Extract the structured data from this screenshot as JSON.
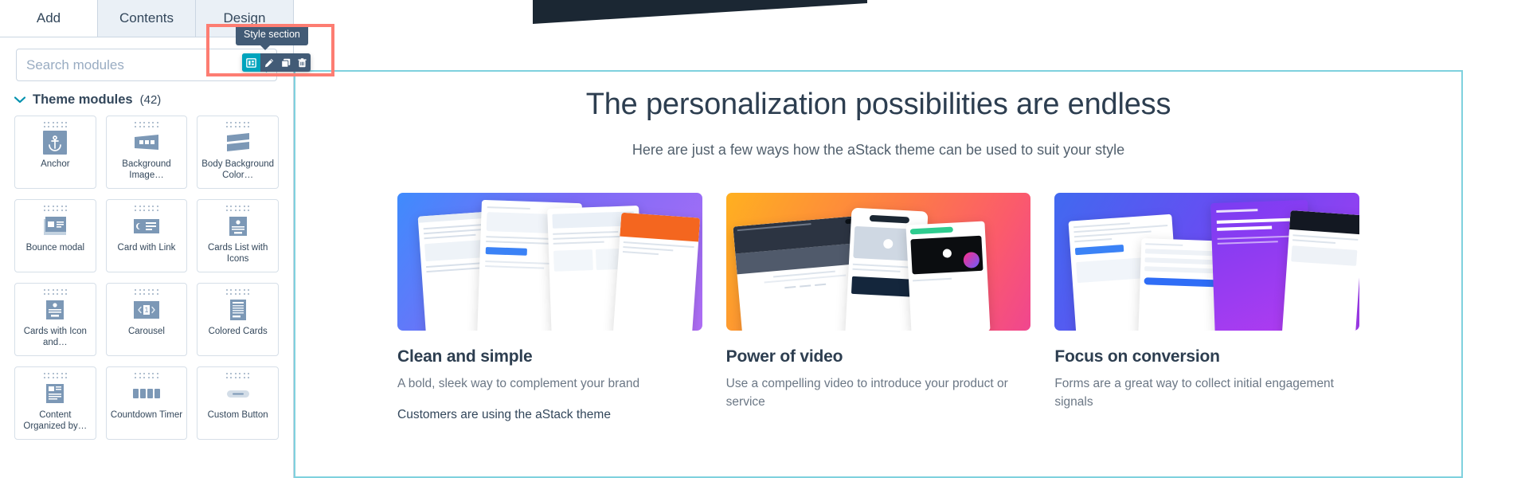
{
  "left_panel": {
    "tabs": [
      {
        "label": "Add",
        "active": true
      },
      {
        "label": "Contents",
        "active": false
      },
      {
        "label": "Design",
        "active": false
      }
    ],
    "search": {
      "placeholder": "Search modules",
      "value": "",
      "icon": "search-icon"
    },
    "section": {
      "chevron_icon": "chevron-down-icon",
      "title": "Theme modules",
      "count": "(42)"
    },
    "modules": [
      {
        "label": "Anchor",
        "icon": "anchor-icon"
      },
      {
        "label": "Background Image…",
        "icon": "background-image-icon"
      },
      {
        "label": "Body Background Color…",
        "icon": "body-background-color-icon"
      },
      {
        "label": "Bounce modal",
        "icon": "bounce-modal-icon"
      },
      {
        "label": "Card with Link",
        "icon": "card-with-link-icon"
      },
      {
        "label": "Cards List with Icons",
        "icon": "cards-list-with-icons-icon"
      },
      {
        "label": "Cards with Icon and…",
        "icon": "cards-with-icon-icon"
      },
      {
        "label": "Carousel",
        "icon": "carousel-icon"
      },
      {
        "label": "Colored Cards",
        "icon": "colored-cards-icon"
      },
      {
        "label": "Content Organized by…",
        "icon": "content-organized-icon"
      },
      {
        "label": "Countdown Timer",
        "icon": "countdown-timer-icon"
      },
      {
        "label": "Custom Button",
        "icon": "custom-button-icon"
      }
    ]
  },
  "section_toolbar": {
    "tooltip": "Style section",
    "buttons": [
      {
        "name": "style-section-button",
        "icon": "layout-style-icon",
        "active": true
      },
      {
        "name": "edit-section-button",
        "icon": "pencil-icon",
        "active": false
      },
      {
        "name": "clone-section-button",
        "icon": "copy-icon",
        "active": false
      },
      {
        "name": "delete-section-button",
        "icon": "trash-icon",
        "active": false
      }
    ]
  },
  "canvas": {
    "hero": {
      "heading": "The personalization possibilities are endless",
      "subheading": "Here are just a few ways how the aStack theme can be used to suit your style"
    },
    "cards": [
      {
        "title": "Clean and simple",
        "description": "A bold, sleek way to complement your brand",
        "body": "Customers are using the aStack theme",
        "gradient_start": "#3f8bfd",
        "gradient_end": "#b06ef5"
      },
      {
        "title": "Power of video",
        "description": "Use a compelling video to introduce your product or service",
        "body": "",
        "gradient_start": "#ffb020",
        "gradient_end": "#fb5b6b"
      },
      {
        "title": "Focus on conversion",
        "description": "Forms are a great way to collect initial engagement signals",
        "body": "",
        "gradient_start": "#4169f0",
        "gradient_end": "#a43bf0"
      }
    ]
  },
  "colors": {
    "accent_teal": "#00a4bd",
    "toolbar_dark": "#425b76",
    "selection_border": "#7fd1de",
    "annotation_red": "#fd7d72",
    "module_icon": "#7c98b6"
  }
}
